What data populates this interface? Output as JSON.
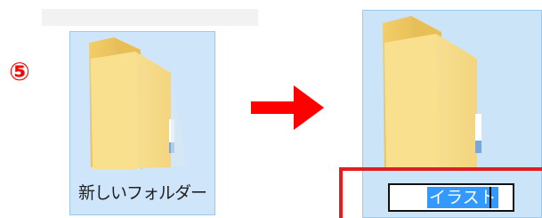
{
  "step": {
    "number": "⑤"
  },
  "before": {
    "folder_name": "新しいフォルダー",
    "folder_icon": "folder-icon"
  },
  "after": {
    "rename_value": "イラスト",
    "folder_icon": "folder-icon"
  },
  "colors": {
    "accent_red": "#e02020",
    "selection_blue": "#3399ff",
    "tile_highlight": "#cce4f7",
    "folder_yellow": "#f5d77a"
  }
}
